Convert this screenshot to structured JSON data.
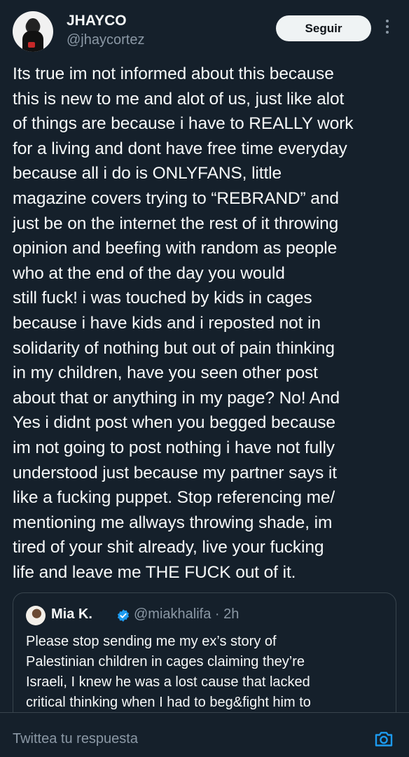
{
  "author": {
    "name": "JHAYCO",
    "handle": "@jhaycortez",
    "follow_label": "Seguir"
  },
  "tweet": {
    "text": "Its true im not informed about this because\nthis is new to me and alot of us, just like alot\nof things are because i have to REALLY work\nfor a living and dont have free time everyday\nbecause all i do is ONLYFANS, little\nmagazine covers trying to “REBRAND”  and\njust be on the internet the rest of it throwing\nopinion and beefing with random as people\nwho at the end of the day you would\nstill fuck! i was touched by kids in cages\nbecause i have kids and i reposted not in\nsolidarity of nothing but out of pain thinking\nin my children, have you seen other post\nabout that or anything in my page? No! And\nYes i didnt post when you begged because\nim not going to post nothing i have not fully\nunderstood just because my partner says it\nlike a fucking puppet. Stop referencing me/\nmentioning me allways throwing shade, im\ntired of your shit already, live your fucking\nlife and leave me THE FUCK out of it."
  },
  "quoted": {
    "name": "Mia K.",
    "handle_time": "@miakhalifa · 2h",
    "text": "Please stop sending me my ex’s story of\nPalestinian children in cages claiming they’re\nIsraeli, I knew he was a lost cause that lacked\ncritical thinking when I had to beg&fight him to"
  },
  "reply": {
    "placeholder": "Twittea tu respuesta"
  },
  "colors": {
    "background": "#15202b",
    "accent": "#1d9bf0",
    "muted_text": "#8b98a5"
  },
  "icons": [
    "more-vertical-icon",
    "verified-badge-icon",
    "camera-icon"
  ]
}
